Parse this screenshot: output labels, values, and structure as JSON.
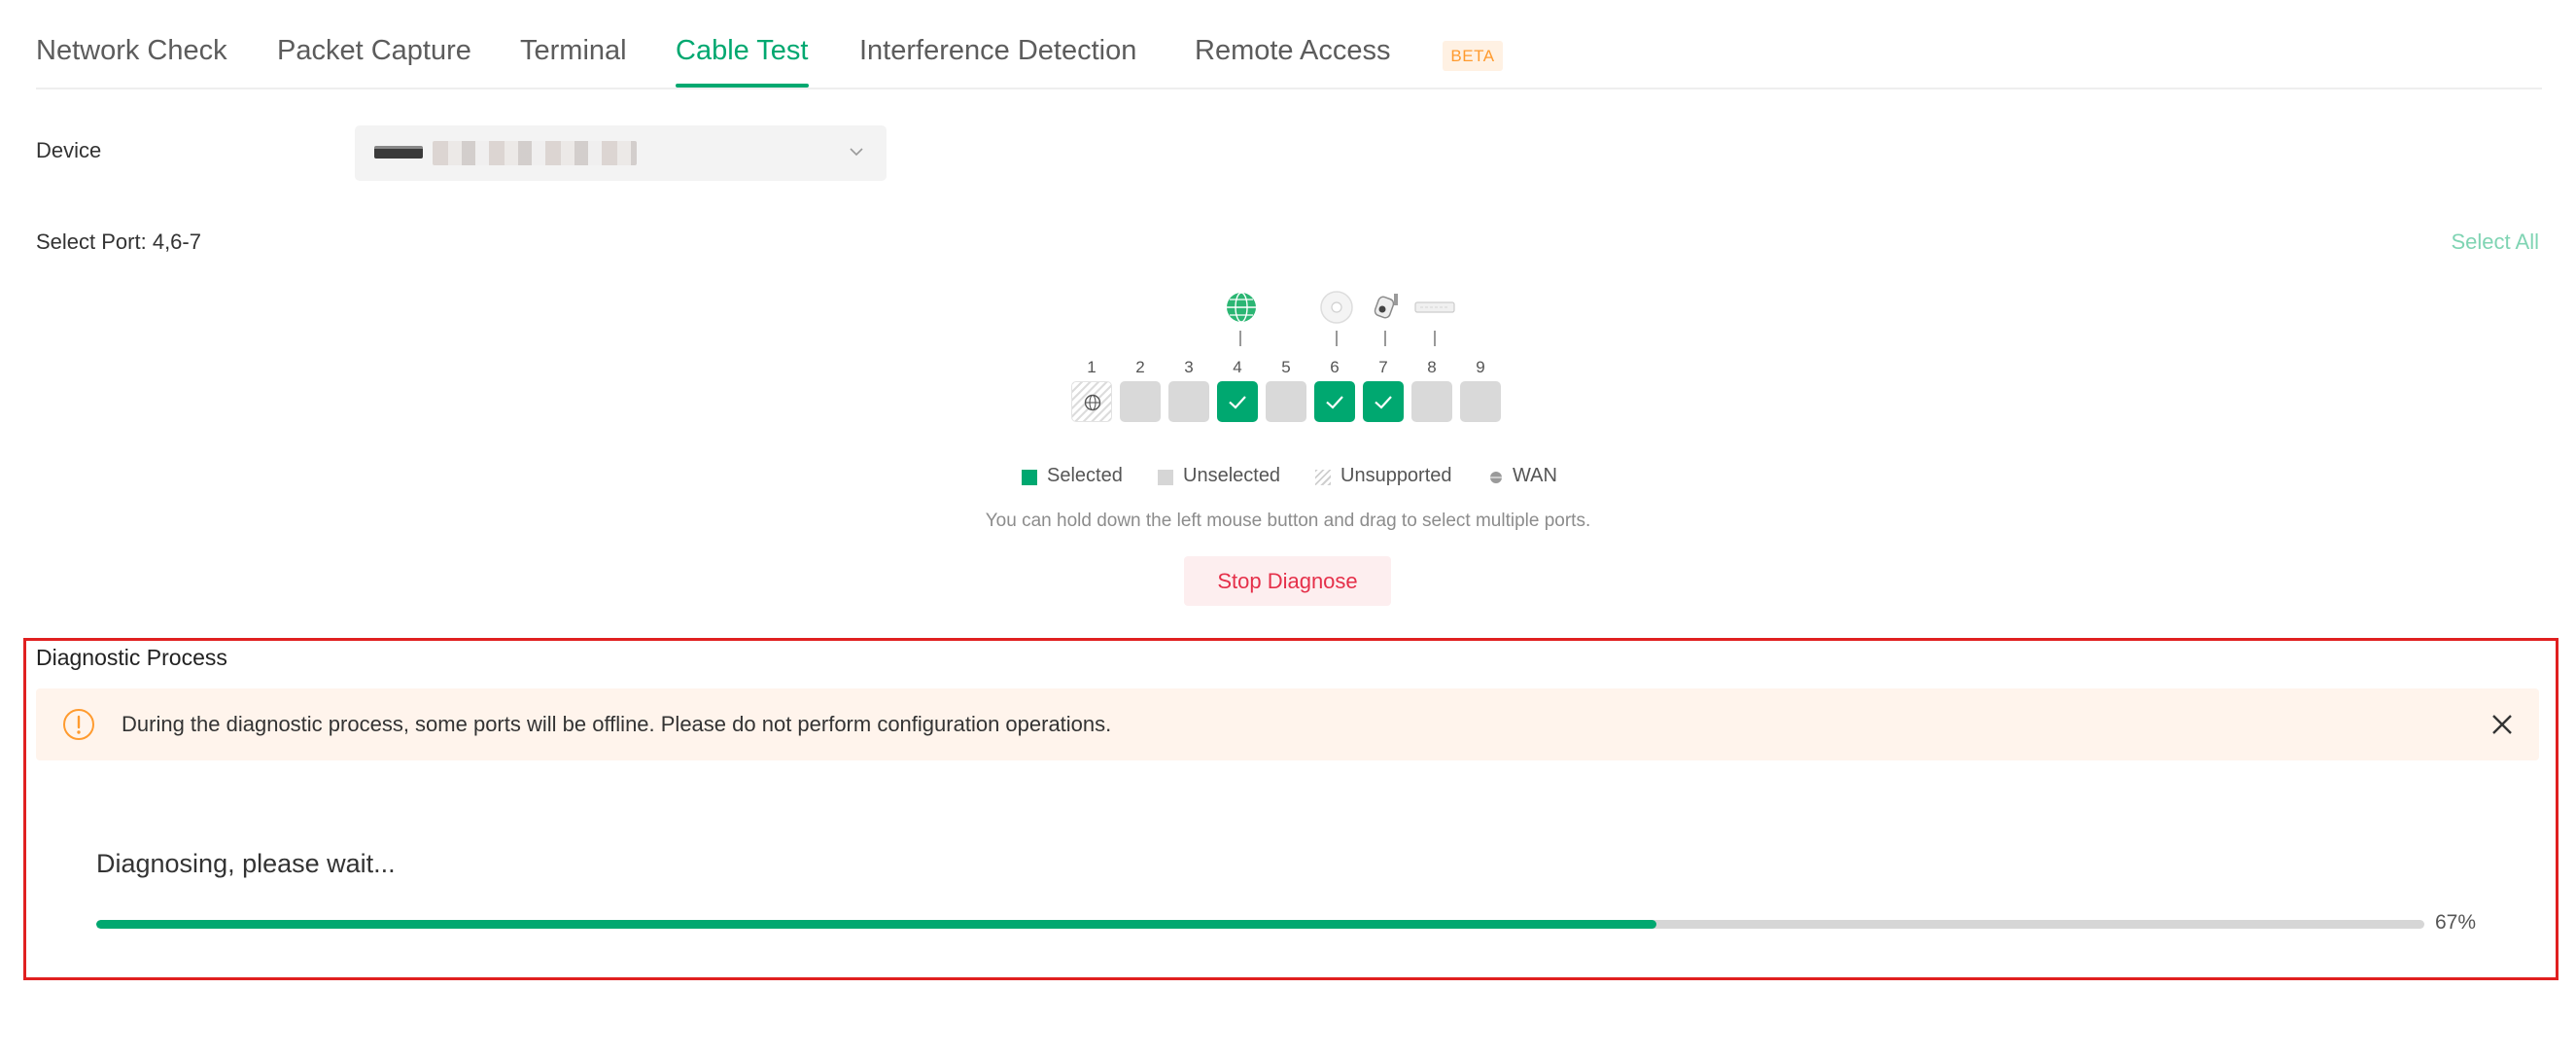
{
  "tabs": [
    {
      "label": "Network Check"
    },
    {
      "label": "Packet Capture"
    },
    {
      "label": "Terminal"
    },
    {
      "label": "Cable Test",
      "active": true
    },
    {
      "label": "Interference Detection"
    },
    {
      "label": "Remote Access",
      "badge": "BETA"
    }
  ],
  "device": {
    "label": "Device",
    "value_obscured": true,
    "dropdown_icon": "chevron-down-icon"
  },
  "ports": {
    "select_label": "Select Port: 4,6-7",
    "select_all": "Select All",
    "items": [
      {
        "num": "1",
        "state": "unsupported",
        "wan": true
      },
      {
        "num": "2",
        "state": "unselected"
      },
      {
        "num": "3",
        "state": "unselected"
      },
      {
        "num": "4",
        "state": "selected",
        "device": "globe-icon"
      },
      {
        "num": "5",
        "state": "unselected"
      },
      {
        "num": "6",
        "state": "selected",
        "device": "access-point-icon"
      },
      {
        "num": "7",
        "state": "selected",
        "device": "camera-icon"
      },
      {
        "num": "8",
        "state": "unselected",
        "device": "switch-icon"
      },
      {
        "num": "9",
        "state": "unselected"
      }
    ],
    "legend": {
      "selected": "Selected",
      "unselected": "Unselected",
      "unsupported": "Unsupported",
      "wan": "WAN"
    },
    "hint": "You can hold down the left mouse button and drag to select multiple ports.",
    "stop_button": "Stop Diagnose"
  },
  "diagnostic": {
    "title": "Diagnostic Process",
    "alert": "During the diagnostic process, some ports will be offline. Please do not perform configuration operations.",
    "status": "Diagnosing, please wait...",
    "progress": 0.67,
    "progress_label": "67%"
  },
  "colors": {
    "accent": "#00a870",
    "danger": "#e5304a",
    "warning": "#ff9b2f",
    "highlight_border": "#e02020"
  }
}
